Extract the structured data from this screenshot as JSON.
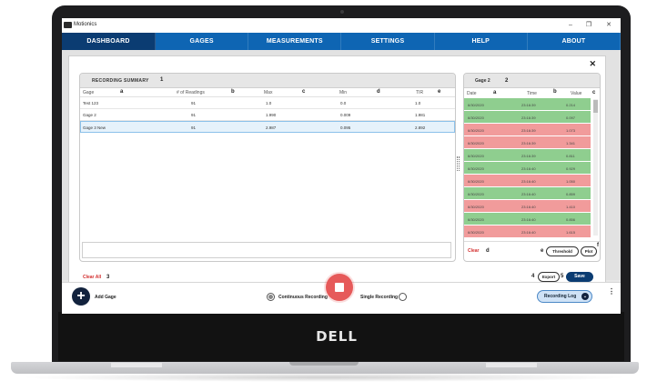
{
  "app": {
    "title": "Motionics"
  },
  "window": {
    "minimize": "–",
    "maximize": "❐",
    "close": "✕"
  },
  "nav": {
    "tabs": [
      "DASHBOARD",
      "GAGES",
      "MEASUREMENTS",
      "SETTINGS",
      "HELP",
      "ABOUT"
    ]
  },
  "dialog": {
    "close": "✕"
  },
  "summary": {
    "title": "RECORDING SUMMARY",
    "marker": "1",
    "columns": [
      "Gage",
      "# of Readings",
      "Max",
      "Min",
      "TIR"
    ],
    "column_letters": [
      "a",
      "b",
      "c",
      "d",
      "e"
    ],
    "rows": [
      [
        "Test 123",
        "91",
        "1.0",
        "0.0",
        "1.0"
      ],
      [
        "Gage 2",
        "91",
        "1.990",
        "0.009",
        "1.981"
      ],
      [
        "Gage 3 New",
        "91",
        "2.987",
        "0.095",
        "2.892"
      ]
    ],
    "clear_all": "Clear All",
    "clear_all_marker": "3"
  },
  "gage2": {
    "title": "Gage 2",
    "marker": "2",
    "columns": [
      "Date",
      "Time",
      "Value"
    ],
    "column_letters": [
      "a",
      "b",
      "c"
    ],
    "rows": [
      [
        "6/30/2020",
        "23:16:39",
        "0.214",
        "good"
      ],
      [
        "6/30/2020",
        "23:16:39",
        "0.097",
        "good"
      ],
      [
        "6/30/2020",
        "23:16:39",
        "1.073",
        "bad"
      ],
      [
        "6/30/2020",
        "23:16:39",
        "1.341",
        "bad"
      ],
      [
        "6/30/2020",
        "23:16:39",
        "0.811",
        "good"
      ],
      [
        "6/30/2020",
        "23:16:40",
        "0.929",
        "good"
      ],
      [
        "6/30/2020",
        "23:16:40",
        "1.050",
        "bad"
      ],
      [
        "6/30/2020",
        "23:16:40",
        "0.859",
        "good"
      ],
      [
        "6/30/2020",
        "23:16:40",
        "1.410",
        "bad"
      ],
      [
        "6/30/2020",
        "23:16:40",
        "0.856",
        "good"
      ],
      [
        "6/30/2020",
        "23:16:40",
        "1.615",
        "bad"
      ]
    ],
    "clear": "Clear",
    "clear_letter": "d",
    "threshold": "Threshold",
    "threshold_letter": "e",
    "plot": "Plot",
    "plot_letter": "f"
  },
  "actions": {
    "export": "Export",
    "export_marker": "4",
    "save": "Save",
    "save_marker": "5"
  },
  "bottombar": {
    "add_glyph": "+",
    "add_gage": "Add Gage",
    "continuous": "Continuous Recording",
    "single": "Single Recording",
    "recording_log": "Recording Log",
    "log_chevron": "⌄",
    "kebab": "⋮"
  },
  "hardware": {
    "brand": "DELL"
  },
  "colors": {
    "nav": "#0e65b3",
    "nav_active": "#0b3c72",
    "good": "#8fce8f",
    "bad": "#f19b9b",
    "record": "#e65a5a",
    "danger": "#d32f2f"
  }
}
